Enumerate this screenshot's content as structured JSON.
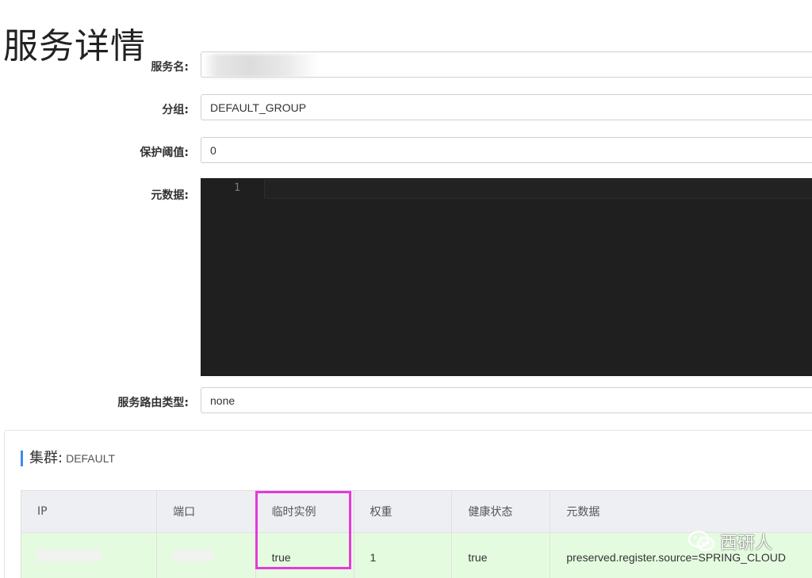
{
  "page": {
    "title": "服务详情"
  },
  "form": {
    "service_name": {
      "label": "服务名:",
      "value": ""
    },
    "group": {
      "label": "分组:",
      "value": "DEFAULT_GROUP"
    },
    "protect_threshold": {
      "label": "保护阈值:",
      "value": "0"
    },
    "metadata": {
      "label": "元数据:",
      "line_number": "1"
    },
    "route_type": {
      "label": "服务路由类型:",
      "value": "none"
    }
  },
  "cluster": {
    "heading_label": "集群:",
    "heading_value": "DEFAULT",
    "columns": [
      "IP",
      "端口",
      "临时实例",
      "权重",
      "健康状态",
      "元数据"
    ],
    "rows": [
      {
        "ip": "",
        "port": "",
        "ephemeral": "true",
        "weight": "1",
        "healthy": "true",
        "metadata": "preserved.register.source=SPRING_CLOUD"
      }
    ]
  },
  "watermark": {
    "text": "西研人"
  },
  "colors": {
    "highlight": "#e43ad8",
    "accent": "#3b8cef",
    "row_bg": "#e5fbe0",
    "editor_bg": "#1f1f1f"
  }
}
